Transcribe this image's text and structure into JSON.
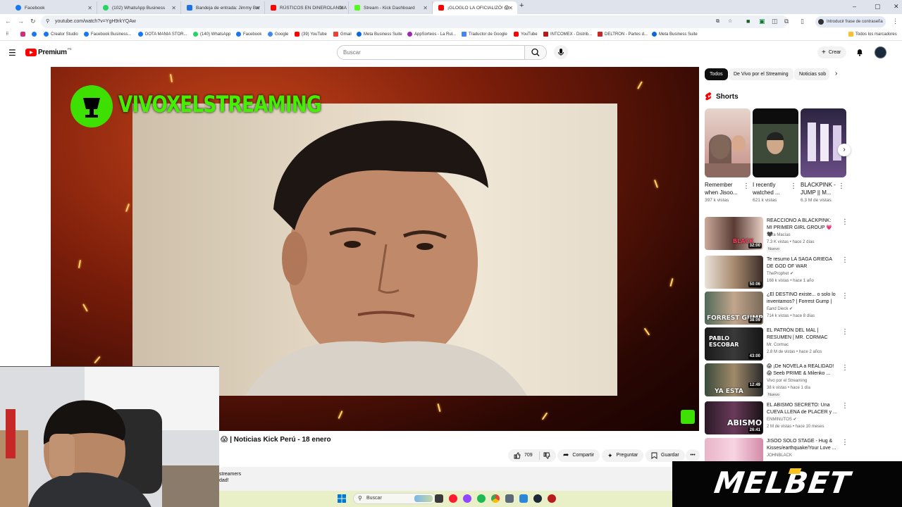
{
  "browser": {
    "tabs": [
      {
        "label": "Facebook",
        "color": "#1877f2"
      },
      {
        "label": "(102) WhatsApp Business",
        "color": "#25d366"
      },
      {
        "label": "Bandeja de entrada: Jimmy Ber",
        "color": "#1a73e8"
      },
      {
        "label": "RÚSTICOS EN DINEROLANDIA",
        "color": "#ff0000"
      },
      {
        "label": "Stream - Kick Dashboard",
        "color": "#53fc18"
      },
      {
        "label": "¡GLOGLO LA OFICIALIZÓ! 😱",
        "color": "#ff0000"
      }
    ],
    "url": "youtube.com/watch?v=YgH9rkYQAw",
    "password_prompt": "Introducir frase de contraseña",
    "bookmarks": [
      "Creator Studio",
      "Facebook Business...",
      "DOTA MANIA STOR...",
      "(140) WhatsApp",
      "Facebook",
      "Google",
      "(39) YouTube",
      "Gmail",
      "Meta Business Suite",
      "AppSorteos - La Rul...",
      "Traductor de Google",
      "YouTube",
      "INTCOMEX - Distrib...",
      "DELTRON - Partes d...",
      "Meta Business Suite"
    ],
    "all_bookmarks": "Todos los marcadores"
  },
  "youtube": {
    "logo_text": "Premium",
    "region": "PE",
    "search_placeholder": "Buscar",
    "create_label": "Crear"
  },
  "player": {
    "channel_overlay": "VIVOXELSTREAMING"
  },
  "video": {
    "title": "😱 | Noticias Kick Perú - 18 enero",
    "likes": "709",
    "share": "Compartir",
    "ask": "Preguntar",
    "save": "Guardar",
    "desc_line1": "streamers",
    "desc_line2": "dad!"
  },
  "sidebar": {
    "chips": [
      "Todos",
      "De Vivo por el Streaming",
      "Noticias sob"
    ],
    "shorts_heading": "Shorts",
    "shorts": [
      {
        "title": "Remember when Jisoo...",
        "views": "397 k vistas"
      },
      {
        "title": "I recently watched ...",
        "views": "621 k vistas"
      },
      {
        "title": "BLACKPINK - JUMP || M...",
        "views": "6.3 M de vistas"
      }
    ],
    "videos": [
      {
        "title": "REACCIONO A BLACKPINK: MI PRIMER GIRL GROUP 💗🖤",
        "channel": "Sara Macías",
        "meta": "7.3 K vistas • hace 2 días",
        "duration": "32:00",
        "badge": "Nuevo",
        "thumb_text": "BLACK"
      },
      {
        "title": "Te resumo LA SAGA GRIEGA DE GOD OF WAR",
        "channel": "TheProphet ✔",
        "meta": "168 k vistas • hace 1 año",
        "duration": "50:06",
        "badge": "",
        "thumb_text": ""
      },
      {
        "title": "¿El DESTINO existe... o solo lo inventamos? | Forrest Gump | ...",
        "channel": "Fand Dieck ✔",
        "meta": "714 k vistas • hace 8 días",
        "duration": "38:09",
        "badge": "",
        "thumb_text": "FORREST GUMP"
      },
      {
        "title": "EL PATRÓN DEL MAL | RESUMEN | MR. CORMAC",
        "channel": "Mr. Cormac",
        "meta": "2.8 M de vistas • hace 2 años",
        "duration": "43:00",
        "badge": "",
        "thumb_text": "PABLO ESCOBAR"
      },
      {
        "title": "😱 ¡De NOVELA a REALIDAD! 😱 Seeb PRIME & Milenko ...",
        "channel": "Vivo por el Streaming",
        "meta": "38 k vistas • hace 1 día",
        "duration": "12:49",
        "badge": "Nuevo",
        "thumb_text": "YA ESTA"
      },
      {
        "title": "EL ABISMO SECRETO: Una CUEVA LLENA de PLACER y ...",
        "channel": "ENMINUTOS ✔",
        "meta": "2 M de vistas • hace 10 meses",
        "duration": "26:41",
        "badge": "",
        "thumb_text": "ABISMO"
      },
      {
        "title": "JISOO SOLO STAGE - Hug & Kisses/earthquake/Your Love ...",
        "channel": "JOHNBLACK",
        "meta": "",
        "duration": "",
        "badge": "",
        "thumb_text": ""
      }
    ]
  },
  "taskbar": {
    "search_label": "Buscar"
  },
  "ad": {
    "brand": "MELBET"
  }
}
